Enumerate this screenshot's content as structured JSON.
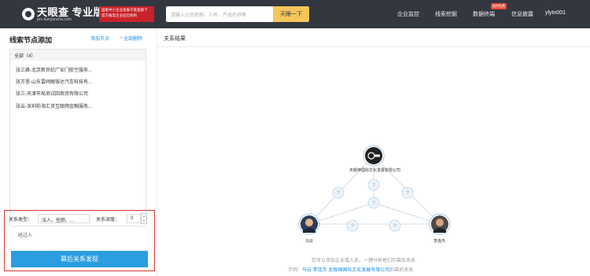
{
  "header": {
    "logo_text": "天眼查 专业版",
    "logo_sub": "pro.tianyancha.com",
    "promo_text": "国家中小企业发展子基金旗下 官方备案企业征信机构",
    "search_placeholder": "请输入公司名称、人名、产品名称等",
    "search_button": "天眼一下",
    "nav": [
      "企业监控",
      "线索挖掘",
      "数据终端",
      "信息披露"
    ],
    "nav_badge": "限时免费",
    "user": "ylytn001"
  },
  "left": {
    "title": "线索节点添加",
    "add_link": "添加节点",
    "clear_link": "* 全部删除",
    "list_header": "全部（4）",
    "items": [
      "张三峰-北京新世纪广安门航空服务...",
      "张万里-山东雷阀醇铵达汽车科技有...",
      "张三-天津市局测试四商贸有限公司",
      "张云-深圳前海汇资互联网金融服务..."
    ],
    "relation_type_label": "关系类型：",
    "relation_type_value": "法人、任职、...",
    "relation_depth_label": "关系深度：",
    "relation_depth_value": "3",
    "person_type": "经过人",
    "discover_button": "幕后关系发现"
  },
  "right": {
    "title": "关系结果",
    "company_label": "天眼神国际文化发展有限公司",
    "person_left": "马云",
    "person_right": "李连杰",
    "hint_line1": "您可以添加企业或人员，一键分析他们的幕后关系",
    "hint_line2_prefix": "示例：",
    "hint_line2_example": "马云 李连杰 太极禅国际文化发展有限公司",
    "hint_line2_suffix": "的幕后关系"
  }
}
